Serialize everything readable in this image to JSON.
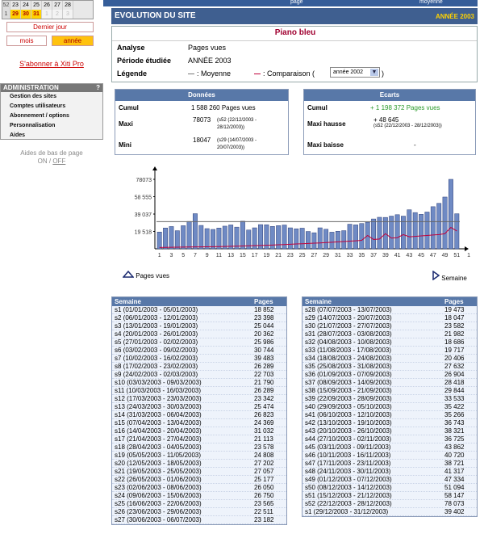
{
  "calendar": {
    "rows": [
      {
        "week": "52",
        "days": [
          "23",
          "24",
          "25",
          "26",
          "27",
          "28"
        ],
        "active": [
          false,
          false,
          false,
          false,
          false,
          false
        ]
      },
      {
        "week": "1",
        "days": [
          "29",
          "30",
          "31",
          "1",
          "2",
          "3"
        ],
        "active": [
          true,
          true,
          true,
          false,
          false,
          false
        ]
      }
    ]
  },
  "nav": {
    "last_day": "Dernier jour",
    "month": "mois",
    "year": "année",
    "subscribe": "S'abonner à Xiti Pro"
  },
  "admin": {
    "title": "ADMINISTRATION",
    "help": "?",
    "items": [
      "Gestion des sites",
      "Comptes utilisateurs",
      "Abonnement / options",
      "Personnalisation",
      "Aides"
    ]
  },
  "helpers": {
    "line1": "Aides de bas de page",
    "on": "ON",
    "sep": " / ",
    "off": "OFF"
  },
  "topbar": {
    "page": "page",
    "moyenne": "moyenne"
  },
  "header": {
    "title": "EVOLUTION DU SITE",
    "year": "ANNÉE 2003"
  },
  "info": {
    "site": "Piano bleu",
    "analyse_label": "Analyse",
    "analyse_value": "Pages vues",
    "periode_label": "Période étudiée",
    "periode_value": "ANNÉE 2003",
    "legende_label": "Légende",
    "moyenne": ": Moyenne",
    "comparaison": ": Comparaison (",
    "select_value": "année 2002",
    "paren_close": ")"
  },
  "donnees": {
    "title": "Données",
    "cumul_label": "Cumul",
    "cumul_value": "1 588 260 Pages vues",
    "maxi_label": "Maxi",
    "maxi_value": "78073",
    "maxi_detail": "(s52 (22/12/2003 - 28/12/2003))",
    "mini_label": "Mini",
    "mini_value": "18047",
    "mini_detail": "(s29 (14/07/2003 - 20/07/2003))"
  },
  "ecarts": {
    "title": "Ecarts",
    "cumul_label": "Cumul",
    "cumul_value": "+ 1 198 372 Pages vues",
    "hausse_label": "Maxi hausse",
    "hausse_value": "+ 48 645",
    "hausse_detail": "(s52 (22/12/2003 - 28/12/2003))",
    "baisse_label": "Maxi baisse",
    "baisse_value": "-"
  },
  "chart_legend": {
    "pages_vues": "Pages vues",
    "semaine": "Semaine"
  },
  "chart_data": {
    "type": "bar",
    "yticks": [
      "78073",
      "58 555",
      "39 037",
      "19 518"
    ],
    "ylim": [
      0,
      78073
    ],
    "average": 30543,
    "xticks": [
      "1",
      "3",
      "5",
      "7",
      "9",
      "11",
      "13",
      "15",
      "17",
      "19",
      "21",
      "23",
      "25",
      "27",
      "29",
      "31",
      "33",
      "35",
      "37",
      "39",
      "41",
      "43",
      "45",
      "47",
      "49",
      "51",
      "1"
    ],
    "values": [
      18852,
      23398,
      25044,
      20362,
      25986,
      30744,
      39483,
      26289,
      22703,
      21790,
      23342,
      25474,
      26823,
      24369,
      31032,
      21113,
      23578,
      27202,
      27057,
      25177,
      26050,
      26750,
      23565,
      22511,
      23182,
      19473,
      18047,
      23582,
      21982,
      18686,
      19717,
      20406,
      27632,
      26904,
      28418,
      29844,
      33533,
      35422,
      35266,
      36743,
      38321,
      36725,
      43862,
      40720,
      38721,
      41317,
      47334,
      51094,
      58147,
      78073,
      39402
    ],
    "comparison": [
      1500,
      1600,
      1700,
      1800,
      1900,
      2000,
      2100,
      2200,
      2300,
      2400,
      2500,
      2600,
      2800,
      3000,
      3200,
      3400,
      3600,
      3800,
      4000,
      4200,
      4500,
      4800,
      5100,
      5400,
      5700,
      6000,
      6300,
      6600,
      7000,
      7400,
      7800,
      8200,
      8600,
      9000,
      9500,
      15000,
      10500,
      11000,
      17000,
      12000,
      12500,
      16000,
      13500,
      14000,
      14500,
      15000,
      15500,
      16000,
      17000,
      24000,
      20000
    ]
  },
  "table_header": {
    "week": "Semaine",
    "views": "Pages vues"
  },
  "table_left": [
    [
      "s1 (01/01/2003 - 05/01/2003)",
      "18 852"
    ],
    [
      "s2 (06/01/2003 - 12/01/2003)",
      "23 398"
    ],
    [
      "s3 (13/01/2003 - 19/01/2003)",
      "25 044"
    ],
    [
      "s4 (20/01/2003 - 26/01/2003)",
      "20 362"
    ],
    [
      "s5 (27/01/2003 - 02/02/2003)",
      "25 986"
    ],
    [
      "s6 (03/02/2003 - 09/02/2003)",
      "30 744"
    ],
    [
      "s7 (10/02/2003 - 16/02/2003)",
      "39 483"
    ],
    [
      "s8 (17/02/2003 - 23/02/2003)",
      "26 289"
    ],
    [
      "s9 (24/02/2003 - 02/03/2003)",
      "22 703"
    ],
    [
      "s10 (03/03/2003 - 09/03/2003)",
      "21 790"
    ],
    [
      "s11 (10/03/2003 - 16/03/2003)",
      "26 289"
    ],
    [
      "s12 (17/03/2003 - 23/03/2003)",
      "23 342"
    ],
    [
      "s13 (24/03/2003 - 30/03/2003)",
      "25 474"
    ],
    [
      "s14 (31/03/2003 - 06/04/2003)",
      "26 823"
    ],
    [
      "s15 (07/04/2003 - 13/04/2003)",
      "24 369"
    ],
    [
      "s16 (14/04/2003 - 20/04/2003)",
      "31 032"
    ],
    [
      "s17 (21/04/2003 - 27/04/2003)",
      "21 113"
    ],
    [
      "s18 (28/04/2003 - 04/05/2003)",
      "23 578"
    ],
    [
      "s19 (05/05/2003 - 11/05/2003)",
      "24 808"
    ],
    [
      "s20 (12/05/2003 - 18/05/2003)",
      "27 202"
    ],
    [
      "s21 (19/05/2003 - 25/05/2003)",
      "27 057"
    ],
    [
      "s22 (26/05/2003 - 01/06/2003)",
      "25 177"
    ],
    [
      "s23 (02/06/2003 - 08/06/2003)",
      "26 050"
    ],
    [
      "s24 (09/06/2003 - 15/06/2003)",
      "26 750"
    ],
    [
      "s25 (16/06/2003 - 22/06/2003)",
      "23 565"
    ],
    [
      "s26 (23/06/2003 - 29/06/2003)",
      "22 511"
    ],
    [
      "s27 (30/06/2003 - 06/07/2003)",
      "23 182"
    ]
  ],
  "table_right": [
    [
      "s28 (07/07/2003 - 13/07/2003)",
      "19 473"
    ],
    [
      "s29 (14/07/2003 - 20/07/2003)",
      "18 047"
    ],
    [
      "s30 (21/07/2003 - 27/07/2003)",
      "23 582"
    ],
    [
      "s31 (28/07/2003 - 03/08/2003)",
      "21 982"
    ],
    [
      "s32 (04/08/2003 - 10/08/2003)",
      "18 686"
    ],
    [
      "s33 (11/08/2003 - 17/08/2003)",
      "19 717"
    ],
    [
      "s34 (18/08/2003 - 24/08/2003)",
      "20 406"
    ],
    [
      "s35 (25/08/2003 - 31/08/2003)",
      "27 632"
    ],
    [
      "s36 (01/09/2003 - 07/09/2003)",
      "26 904"
    ],
    [
      "s37 (08/09/2003 - 14/09/2003)",
      "28 418"
    ],
    [
      "s38 (15/09/2003 - 21/09/2003)",
      "29 844"
    ],
    [
      "s39 (22/09/2003 - 28/09/2003)",
      "33 533"
    ],
    [
      "s40 (29/09/2003 - 05/10/2003)",
      "35 422"
    ],
    [
      "s41 (06/10/2003 - 12/10/2003)",
      "35 266"
    ],
    [
      "s42 (13/10/2003 - 19/10/2003)",
      "36 743"
    ],
    [
      "s43 (20/10/2003 - 26/10/2003)",
      "38 321"
    ],
    [
      "s44 (27/10/2003 - 02/11/2003)",
      "36 725"
    ],
    [
      "s45 (03/11/2003 - 09/11/2003)",
      "43 862"
    ],
    [
      "s46 (10/11/2003 - 16/11/2003)",
      "40 720"
    ],
    [
      "s47 (17/11/2003 - 23/11/2003)",
      "38 721"
    ],
    [
      "s48 (24/11/2003 - 30/11/2003)",
      "41 317"
    ],
    [
      "s49 (01/12/2003 - 07/12/2003)",
      "47 334"
    ],
    [
      "s50 (08/12/2003 - 14/12/2003)",
      "51 094"
    ],
    [
      "s51 (15/12/2003 - 21/12/2003)",
      "58 147"
    ],
    [
      "s52 (22/12/2003 - 28/12/2003)",
      "78 073"
    ],
    [
      "s1 (29/12/2003 - 31/12/2003)",
      "39 402"
    ]
  ]
}
